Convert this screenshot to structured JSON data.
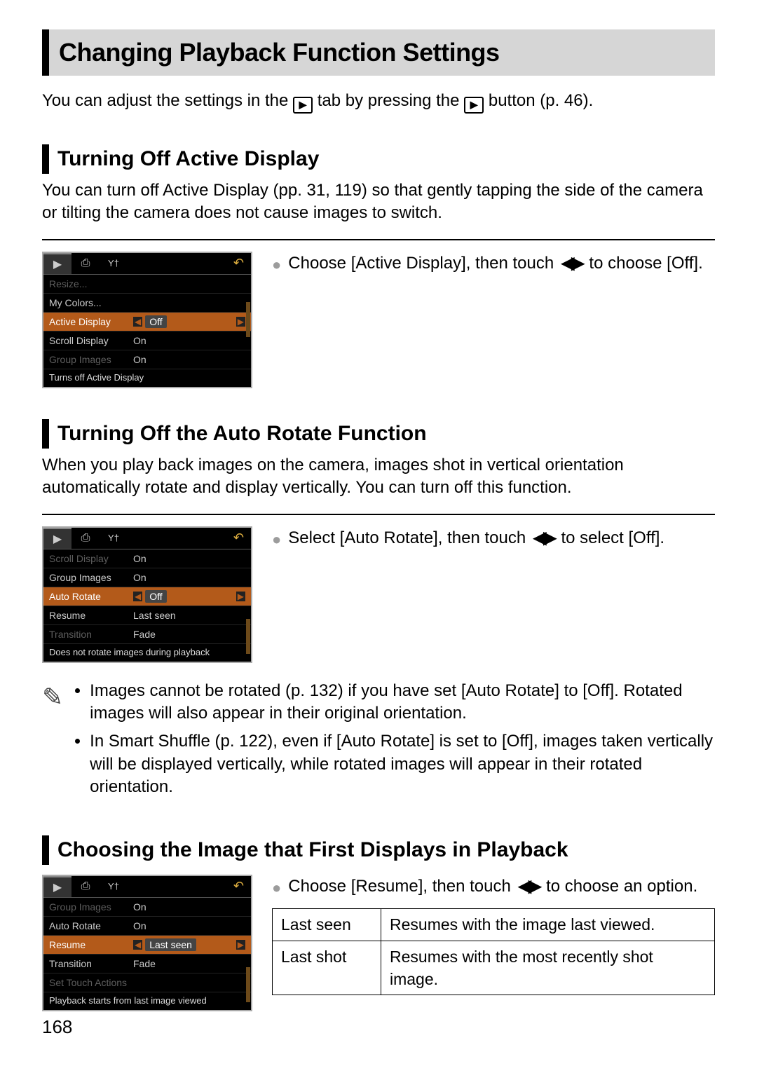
{
  "page_title": "Changing Playback Function Settings",
  "intro": {
    "pre": "You can adjust the settings in the ",
    "mid": " tab by pressing the ",
    "post": " button (p. 46)."
  },
  "section1": {
    "heading": "Turning Off Active Display",
    "body": "You can turn off Active Display (pp. 31, 119) so that gently tapping the side of the camera or tilting the camera does not cause images to switch.",
    "instruction_pre": "Choose [Active Display], then touch ",
    "instruction_post": " to choose [Off].",
    "lcd": {
      "rows": [
        {
          "label": "Resize...",
          "value": "",
          "dim": true
        },
        {
          "label": "My Colors...",
          "value": "",
          "dim": false
        },
        {
          "label": "Active Display",
          "value": "Off",
          "selected": true
        },
        {
          "label": "Scroll Display",
          "value": "On",
          "dim": false
        },
        {
          "label": "Group Images",
          "value": "On",
          "dim": true
        }
      ],
      "help": "Turns off Active Display"
    }
  },
  "section2": {
    "heading": "Turning Off the Auto Rotate Function",
    "body": "When you play back images on the camera, images shot in vertical orientation automatically rotate and display vertically. You can turn off this function.",
    "instruction_pre": "Select [Auto Rotate], then touch ",
    "instruction_post": " to select [Off].",
    "lcd": {
      "rows": [
        {
          "label": "Scroll Display",
          "value": "On",
          "dim": true
        },
        {
          "label": "Group Images",
          "value": "On",
          "dim": false
        },
        {
          "label": "Auto Rotate",
          "value": "Off",
          "selected": true
        },
        {
          "label": "Resume",
          "value": "Last seen",
          "dim": false
        },
        {
          "label": "Transition",
          "value": "Fade",
          "dim": true
        }
      ],
      "help": "Does not rotate images during playback"
    },
    "notes": [
      "Images cannot be rotated (p. 132) if you have set [Auto Rotate] to [Off]. Rotated images will also appear in their original orientation.",
      "In Smart Shuffle (p. 122), even if [Auto Rotate] is set to [Off], images taken vertically will be displayed vertically, while rotated images will appear in their rotated orientation."
    ]
  },
  "section3": {
    "heading": "Choosing the Image that First Displays in Playback",
    "instruction_pre": "Choose [Resume], then touch ",
    "instruction_post": " to choose an option.",
    "lcd": {
      "rows": [
        {
          "label": "Group Images",
          "value": "On",
          "dim": true
        },
        {
          "label": "Auto Rotate",
          "value": "On",
          "dim": false
        },
        {
          "label": "Resume",
          "value": "Last seen",
          "selected": true
        },
        {
          "label": "Transition",
          "value": "Fade",
          "dim": false
        },
        {
          "label": "Set Touch Actions",
          "value": "",
          "dim": true
        }
      ],
      "help": "Playback starts from last image viewed"
    },
    "options": [
      {
        "key": "Last seen",
        "desc": "Resumes with the image last viewed."
      },
      {
        "key": "Last shot",
        "desc": "Resumes with the most recently shot image."
      }
    ]
  },
  "page_number": "168",
  "icons": {
    "play": "▶",
    "print": "⎙",
    "tools": "Y†",
    "return": "↶",
    "lr": "◀▶",
    "pencil": "✎"
  }
}
